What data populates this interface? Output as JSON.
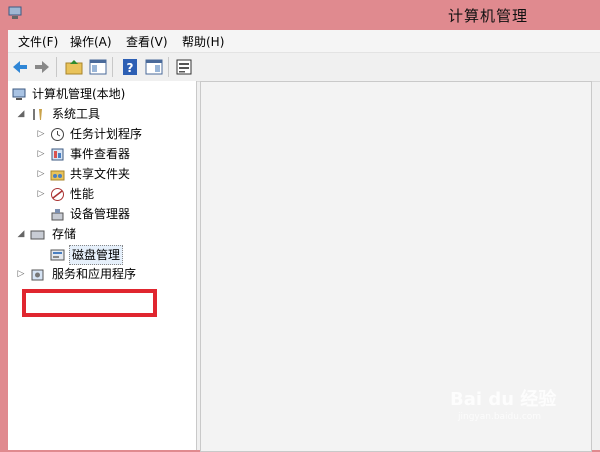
{
  "window": {
    "title": "计算机管理"
  },
  "menu": [
    {
      "label": "文件(F)"
    },
    {
      "label": "操作(A)"
    },
    {
      "label": "查看(V)"
    },
    {
      "label": "帮助(H)"
    }
  ],
  "tree": {
    "root": "计算机管理(本地)",
    "system_tools": "系统工具",
    "task_scheduler": "任务计划程序",
    "event_viewer": "事件查看器",
    "shared_folders": "共享文件夹",
    "performance": "性能",
    "device_manager": "设备管理器",
    "storage": "存储",
    "disk_management": "磁盘管理",
    "services_apps": "服务和应用程序"
  },
  "watermark": {
    "brand": "Bai du 经验",
    "url": "jingyan.baidu.com"
  }
}
